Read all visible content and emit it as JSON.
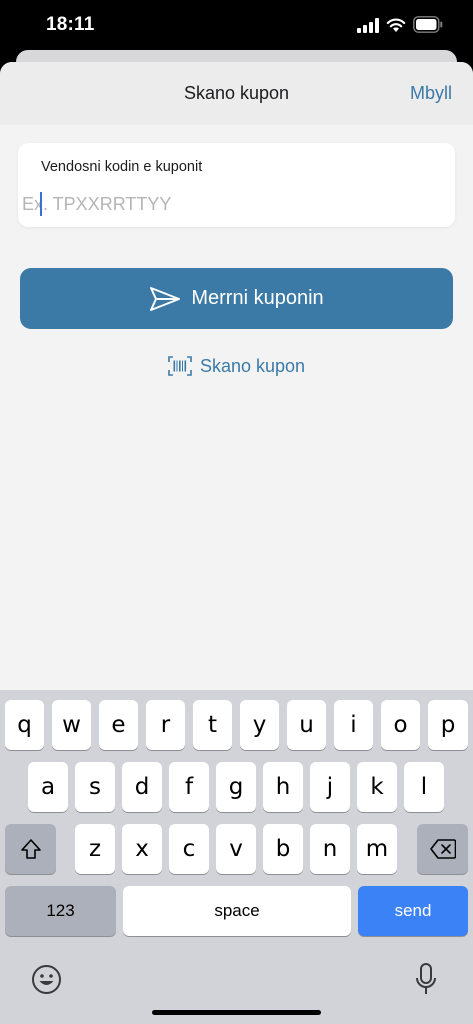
{
  "status_bar": {
    "time": "18:11"
  },
  "header": {
    "title": "Skano kupon",
    "close_label": "Mbyll"
  },
  "form": {
    "label": "Vendosni kodin e kuponit",
    "placeholder": "Ex. TPXXRRTTYY",
    "value": ""
  },
  "actions": {
    "send_label": "Merrni kuponin",
    "scan_label": "Skano kupon"
  },
  "colors": {
    "accent": "#3b7aa7",
    "keyboard_bg": "#d1d3d9",
    "send_key": "#3b82f6"
  },
  "keyboard": {
    "row1": [
      "q",
      "w",
      "e",
      "r",
      "t",
      "y",
      "u",
      "i",
      "o",
      "p"
    ],
    "row2": [
      "a",
      "s",
      "d",
      "f",
      "g",
      "h",
      "j",
      "k",
      "l"
    ],
    "row3": [
      "z",
      "x",
      "c",
      "v",
      "b",
      "n",
      "m"
    ],
    "numbers_label": "123",
    "space_label": "space",
    "send_label": "send",
    "icons": [
      "shift-icon",
      "backspace-icon",
      "emoji-icon",
      "microphone-icon"
    ]
  }
}
